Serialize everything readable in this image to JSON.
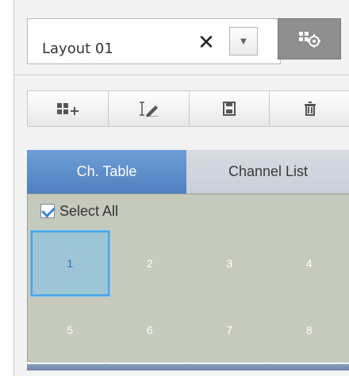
{
  "layout_toolbar": {
    "layout_name": "Layout 01",
    "clear_label": "✕",
    "dropdown_icon": "dropdown-arrow-icon",
    "settings_icon": "layout-settings-icon"
  },
  "actions": {
    "buttons": [
      {
        "icon": "add-layout-icon"
      },
      {
        "icon": "rename-layout-icon"
      },
      {
        "icon": "save-icon"
      },
      {
        "icon": "delete-icon"
      }
    ]
  },
  "tabs": [
    {
      "label": "Ch. Table",
      "active": true
    },
    {
      "label": "Channel List",
      "active": false
    }
  ],
  "panel": {
    "select_all_label": "Select All",
    "channels": [
      "1",
      "2",
      "3",
      "4",
      "5",
      "6",
      "7",
      "8"
    ],
    "selected_channel": "1"
  }
}
